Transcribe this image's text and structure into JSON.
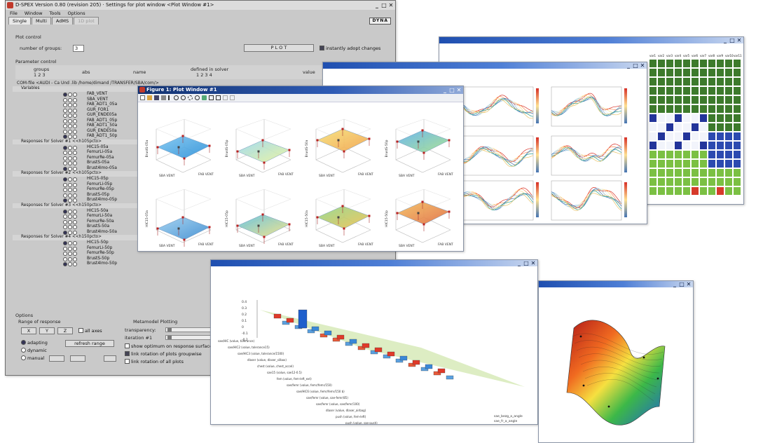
{
  "main_window": {
    "title": "D-SPEX  Version 0.80 (revision 205) · Settings for plot window <Plot Window #1>",
    "menu": [
      "File",
      "Window",
      "Tools",
      "Options"
    ],
    "tabs": [
      "Single",
      "Multi",
      "AdMS",
      "1D plot"
    ],
    "logo": "DYNA",
    "plot_control_label": "Plot control",
    "groups_label": "number of groups:",
    "groups_value": "3",
    "plot_button": "P L O T",
    "instant_adopt": "instantly adopt changes",
    "param_control_label": "Parameter control",
    "col_groups": "groups",
    "col_groups_nums": "1  2  3",
    "col_abs": "abs",
    "col_name": "name",
    "col_defined": "defined in solver",
    "col_defined_nums": "1  2  3  4",
    "col_value": "value",
    "path": "COM-file <AUDI - Ca Und .lib /home/dimand /TRANSFER/SBA/com/>",
    "sections": [
      {
        "title": "Variables",
        "rows": [
          "FAB_VENT",
          "SBA_VENT",
          "FAB_ADT1_05a",
          "GUR_FOR1",
          "GUR_ENDE05a",
          "FAB_ADT1_05p",
          "FAB_ADT1_50a",
          "GUR_ENDE50a",
          "FAB_ADT1_50p"
        ]
      },
      {
        "title": "Responses for Solver #1 <<h105pcto>",
        "rows": [
          "HIC15-05a",
          "FemurLi-05a",
          "FemurRe-05a",
          "BrustS-05a",
          "Brust4lmo-05a"
        ]
      },
      {
        "title": "Responses for Solver #2 <<h105pcto>",
        "rows": [
          "HIC15-05p",
          "FemurLi-05p",
          "FemurRe-05p",
          "BrustS-05p",
          "Brust4lmo-05p"
        ]
      },
      {
        "title": "Responses for Solver #3 <<h150pcto>",
        "rows": [
          "HIC15-50a",
          "FemurLi-50a",
          "FemurRe-50a",
          "BrustS-50a",
          "Brust4lmo-50a"
        ]
      },
      {
        "title": "Responses for Solver #4 <<h150pcto>",
        "rows": [
          "HIC15-50p",
          "FemurLi-50p",
          "FemurRe-50p",
          "BrustS-50p",
          "Brust4lmo-50p"
        ]
      }
    ],
    "options_label": "Options",
    "range_label": "Range of response",
    "range_buttons": [
      "X",
      "Y",
      "Z"
    ],
    "all_axes": "all axes",
    "adapting": "adapting",
    "dynamic": "dynamic",
    "manual": "manual",
    "refresh_range": "refresh range",
    "metamodel_label": "Metamodel Plotting",
    "transparency": "transparency:",
    "iteration": "iteration  #1",
    "show_optimum": "show optimum on response surface",
    "link_groupwise": "link rotation of plots groupwise",
    "link_all": "link rotation of all plots"
  },
  "plot_window": {
    "title": "Figure 1: Plot Window #1",
    "ylabels": [
      "BrustS-05a",
      "BrustS-05p",
      "BrustS-50a",
      "BrustS-50p",
      "HIC15-05a",
      "HIC15-05p",
      "HIC15-50a",
      "HIC15-50p"
    ],
    "xlabel_left": "SBA VENT",
    "xlabel_right": "FAB VENT"
  },
  "curve_window": {
    "panel_count": 6
  },
  "heatmap_window": {
    "col_labels": [
      "var1",
      "var2",
      "var3",
      "var4",
      "var5",
      "var6",
      "var7",
      "var8",
      "var9",
      "var10",
      "var11",
      "var12"
    ]
  },
  "bar3d_window": {
    "ticks": [
      "0.4",
      "0.3",
      "0.2",
      "0.1",
      "0",
      "-0.1",
      "-0.2"
    ],
    "row_labels": [
      "sae/HIC (value, tolerance)",
      "sae/HIC2 (value, tolerance15)",
      "sae/HIC3 (value, tolerance/1500)",
      "dlaser (value, dlaser_silbox)",
      "chest (value, chest_accel)",
      "sae15 (value, sae12-0.5)",
      "fem (value, fem-left_ext)",
      "sae/femr (value, femr/femr/150)",
      "sae/HIC6 (value, femr/femr/150 b)",
      "sae/femr (value, sae-femr/85)",
      "sae/femr (value, sae/femr/100)",
      "dlaser (value, dlaser_airbag)",
      "push (value, fem-left)",
      "push (value, sae-push)"
    ],
    "legend_a": "sae_bezg_a_angle",
    "legend_b": "sae_fr_a_angle"
  },
  "surface_window": {},
  "colors": {
    "accent": "#1f4fb0",
    "dialog_bg": "#c9c9c9"
  }
}
